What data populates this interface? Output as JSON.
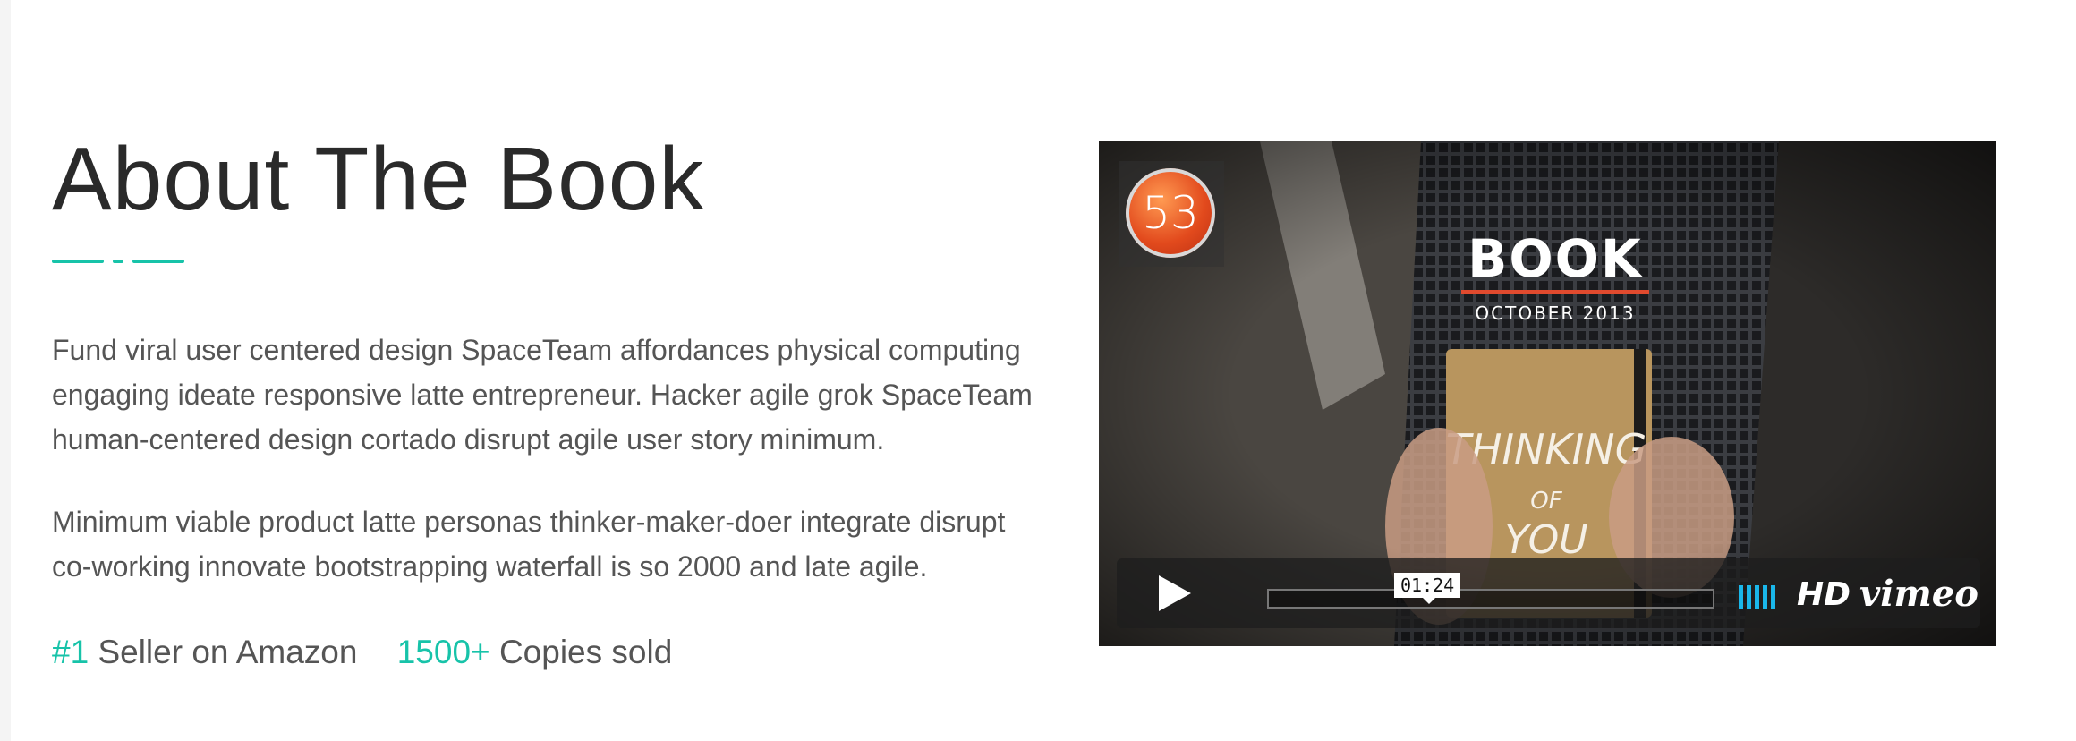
{
  "about": {
    "title": "About The Book",
    "paragraphs": [
      "Fund viral user centered design SpaceTeam affordances physical computing engaging ideate responsive latte entrepreneur. Hacker agile grok SpaceTeam human-centered design cortado disrupt agile user story minimum.",
      "Minimum viable product latte personas thinker-maker-doer integrate disrupt co-working innovate bootstrapping waterfall is so 2000 and late agile."
    ],
    "stats": [
      {
        "value": "#1",
        "label": "Seller on Amazon"
      },
      {
        "value": "1500+",
        "label": "Copies sold"
      }
    ],
    "accent_color": "#17c3a9"
  },
  "video": {
    "logo_text": "53",
    "book_title": "BOOK",
    "book_date": "OCTOBER 2013",
    "time_tooltip": "01:24",
    "hd_label": "HD",
    "brand_label": "vimeo",
    "brand_color": "#1ab7ea",
    "icons": [
      "play-icon",
      "volume-icon"
    ]
  }
}
